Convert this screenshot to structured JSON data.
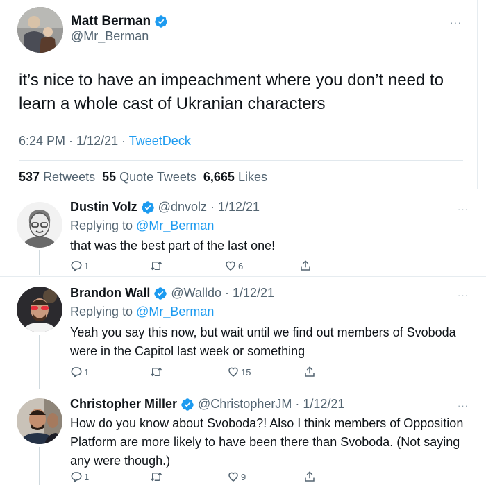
{
  "main_tweet": {
    "author_name": "Matt Berman",
    "author_handle": "@Mr_Berman",
    "text": "it’s nice to have an impeachment where you don’t need to learn a whole cast of Ukranian characters",
    "time": "6:24 PM",
    "sep": " · ",
    "date": "1/12/21",
    "source": "TweetDeck",
    "retweets_count": "537",
    "retweets_label": "Retweets",
    "quotes_count": "55",
    "quotes_label": "Quote Tweets",
    "likes_count": "6,665",
    "likes_label": "Likes",
    "more": "···"
  },
  "replies": [
    {
      "author_name": "Dustin Volz",
      "author_handle": "@dnvolz",
      "date": "· 1/12/21",
      "replying_label": "Replying to",
      "replying_handle": "@Mr_Berman",
      "text": "that was the best part of the last one!",
      "reply_count": "1",
      "retweet_count": "",
      "like_count": "6",
      "more": "···"
    },
    {
      "author_name": "Brandon Wall",
      "author_handle": "@Walldo",
      "date": "· 1/12/21",
      "replying_label": "Replying to",
      "replying_handle": "@Mr_Berman",
      "text": "Yeah you say this now, but wait until we find out members of Svoboda were in the Capitol last week or something",
      "reply_count": "1",
      "retweet_count": "",
      "like_count": "15",
      "more": "···"
    },
    {
      "author_name": "Christopher Miller",
      "author_handle": "@ChristopherJM",
      "date": "· 1/12/21",
      "text": "How do you know about Svoboda?! Also I think members of Opposition Platform are more likely to have been there than Svoboda. (Not saying any were though.)",
      "reply_count": "1",
      "retweet_count": "",
      "like_count": "9",
      "more": "···"
    }
  ],
  "colors": {
    "accent": "#1d9bf0",
    "text": "#0f1419",
    "secondary": "#536471",
    "divider": "#e6ecf0"
  },
  "icons": [
    "verified-badge-icon",
    "reply-icon",
    "retweet-icon",
    "like-icon",
    "share-icon",
    "more-icon"
  ]
}
